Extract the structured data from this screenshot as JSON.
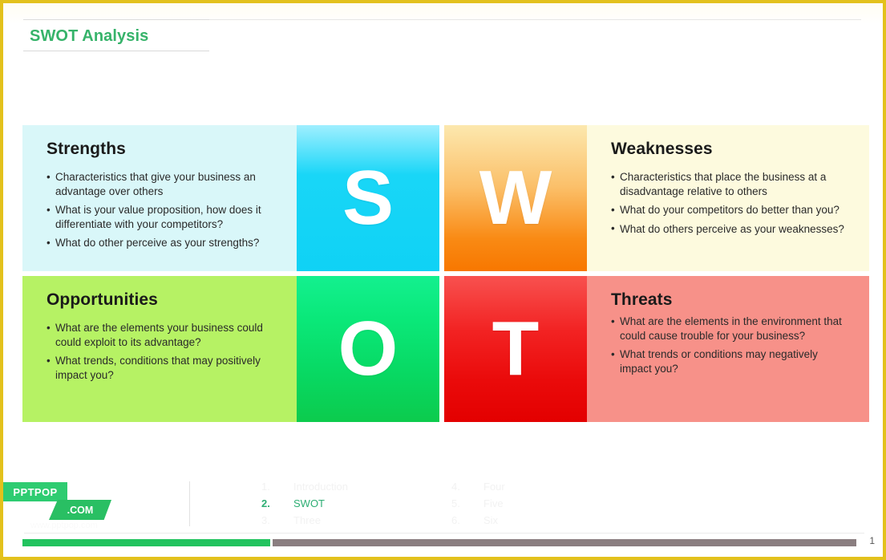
{
  "slide": {
    "title": "SWOT Analysis",
    "page_number": "1",
    "border_color": "#e3c11c",
    "title_color": "#36b36a"
  },
  "quadrants": [
    {
      "heading": "Strengths",
      "letter": "S",
      "panel_color": "#d9f7f9",
      "tile_color": "#0fd2f5",
      "bullets": [
        "Characteristics that give your business an advantage over others",
        "What is your value proposition, how does it differentiate with your competitors?",
        "What do other perceive as your strengths?"
      ]
    },
    {
      "heading": "Weaknesses",
      "letter": "W",
      "panel_color": "#fdfade",
      "tile_color": "#f87700",
      "bullets": [
        "Characteristics that place the business at a disadvantage relative to others",
        "What do your competitors do better than you?",
        "What do others perceive as your weaknesses?"
      ]
    },
    {
      "heading": "Opportunities",
      "letter": "O",
      "panel_color": "#b6f264",
      "tile_color": "#0ad878",
      "bullets": [
        "What are the elements your business could could exploit to its advantage?",
        "What trends, conditions that may positively impact you?"
      ]
    },
    {
      "heading": "Threats",
      "letter": "T",
      "panel_color": "#f79189",
      "tile_color": "#ea0a0a",
      "bullets": [
        "What are the elements in the environment that could cause trouble for your business?",
        "What trends or conditions may negatively impact you?"
      ]
    }
  ],
  "nav": {
    "left_column": [
      {
        "number": "1.",
        "label": "Introduction",
        "active": false
      },
      {
        "number": "2.",
        "label": "SWOT",
        "active": true
      },
      {
        "number": "3.",
        "label": "Three",
        "active": false
      }
    ],
    "right_column": [
      {
        "number": "4.",
        "label": "Four",
        "active": false
      },
      {
        "number": "5.",
        "label": "Five",
        "active": false
      },
      {
        "number": "6.",
        "label": "Six",
        "active": false
      }
    ]
  },
  "logo": {
    "name": "PPTPOP",
    "tld": ".COM",
    "url": "www.pptpop.com"
  },
  "progress": {
    "percent": 30,
    "fill_color": "#22c35e",
    "track_color": "#8a7e80"
  }
}
